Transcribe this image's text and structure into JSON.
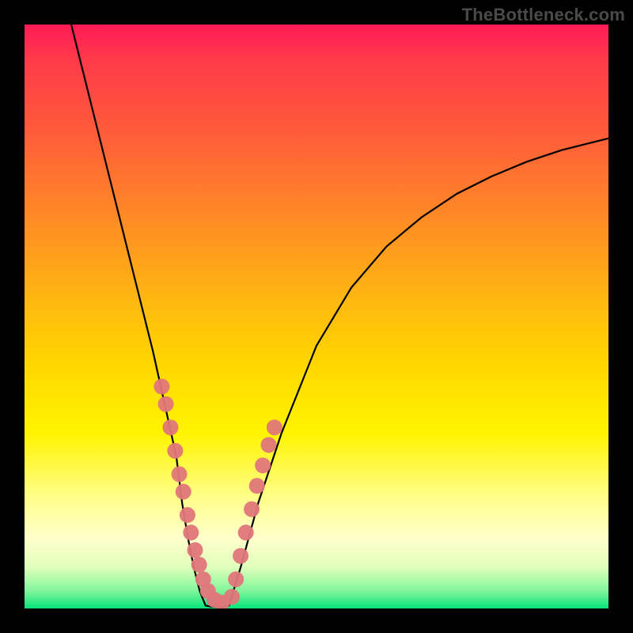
{
  "watermark": "TheBottleneck.com",
  "chart_data": {
    "type": "line",
    "title": "",
    "xlabel": "",
    "ylabel": "",
    "xlim": [
      0,
      100
    ],
    "ylim": [
      0,
      100
    ],
    "grid": false,
    "legend": false,
    "gradient": {
      "top_color": "#ff1a56",
      "mid_color": "#ffd600",
      "bottom_color": "#06e47a"
    },
    "series": [
      {
        "name": "left-branch",
        "color": "#000000",
        "x": [
          8,
          10,
          12,
          14,
          16,
          18,
          20,
          22,
          24,
          26,
          27,
          28,
          29,
          30,
          31
        ],
        "y": [
          100,
          92,
          84,
          76,
          68,
          60,
          52,
          44,
          35,
          26,
          18,
          12,
          7,
          3,
          0.5
        ],
        "stroke_width": 2.2
      },
      {
        "name": "valley-floor",
        "color": "#000000",
        "x": [
          31,
          32,
          33,
          34,
          35
        ],
        "y": [
          0.5,
          0.3,
          0.3,
          0.3,
          0.5
        ],
        "stroke_width": 2.2
      },
      {
        "name": "right-branch",
        "color": "#000000",
        "x": [
          35,
          37,
          40,
          44,
          50,
          56,
          62,
          68,
          74,
          80,
          86,
          92,
          98,
          100
        ],
        "y": [
          0.5,
          7,
          18,
          30,
          45,
          55,
          62,
          67,
          71,
          74,
          76.5,
          78.5,
          80,
          80.5
        ],
        "stroke_width": 2.2
      },
      {
        "name": "left-markers",
        "type": "scatter",
        "color": "#e0767a",
        "marker_radius": 10,
        "x": [
          23.5,
          24.2,
          25.0,
          25.8,
          26.5,
          27.2,
          27.9,
          28.5,
          29.2,
          29.9,
          30.6,
          31.4,
          32.5,
          33.8
        ],
        "y": [
          38,
          35,
          31,
          27,
          23,
          20,
          16,
          13,
          10,
          7.5,
          5,
          3,
          1.5,
          1
        ]
      },
      {
        "name": "right-markers",
        "type": "scatter",
        "color": "#e0767a",
        "marker_radius": 10,
        "x": [
          35.5,
          36.2,
          37.0,
          37.9,
          38.9,
          39.8,
          40.8,
          41.8,
          42.8
        ],
        "y": [
          2,
          5,
          9,
          13,
          17,
          21,
          24.5,
          28,
          31
        ]
      }
    ]
  }
}
